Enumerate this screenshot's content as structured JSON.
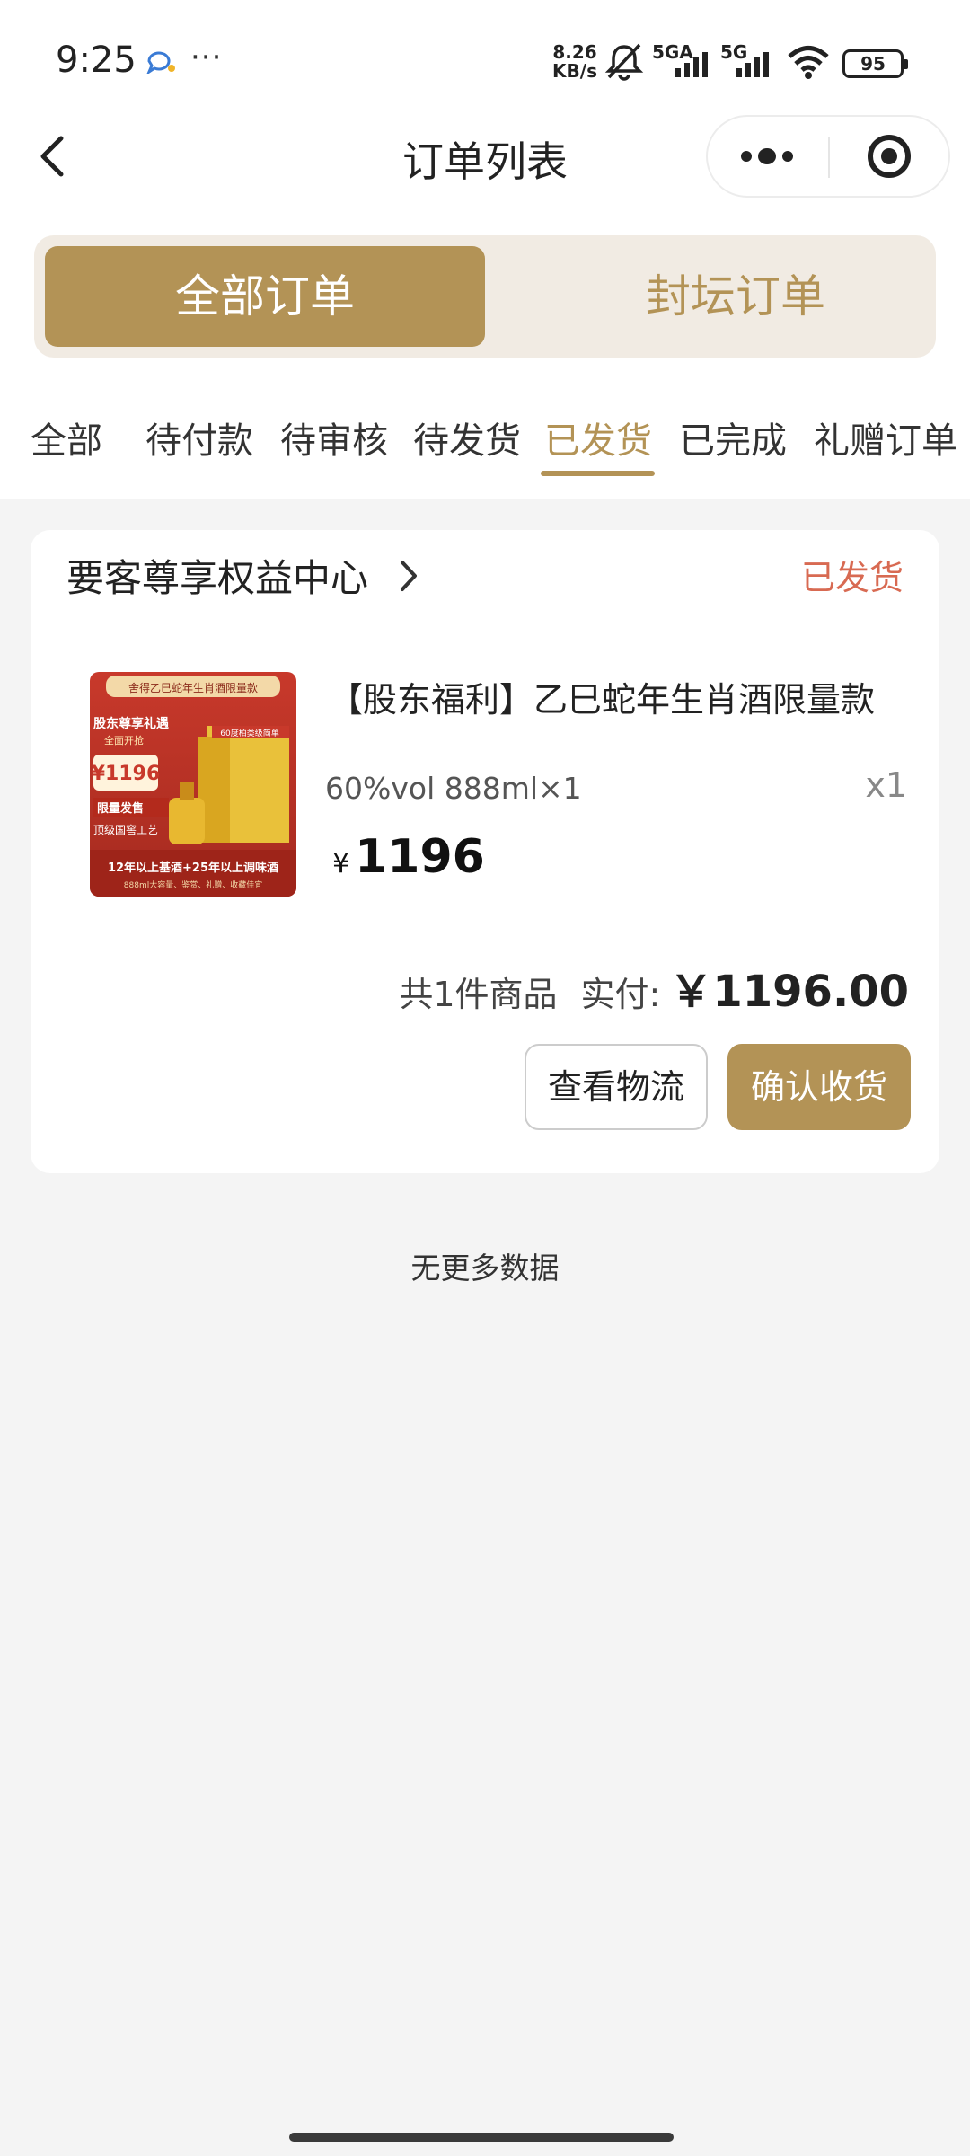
{
  "status_bar": {
    "time": "9:25",
    "more": "···",
    "speed_value": "8.26",
    "speed_unit": "KB/s",
    "network1": "5GA",
    "network2": "5G",
    "battery": "95"
  },
  "nav": {
    "title": "订单列表"
  },
  "segment": {
    "items": [
      {
        "label": "全部订单",
        "active": true
      },
      {
        "label": "封坛订单",
        "active": false
      }
    ]
  },
  "tabs": [
    {
      "label": "全部"
    },
    {
      "label": "待付款"
    },
    {
      "label": "待审核"
    },
    {
      "label": "待发货"
    },
    {
      "label": "已发货",
      "active": true
    },
    {
      "label": "已完成"
    },
    {
      "label": "礼赠订单"
    }
  ],
  "order": {
    "shop_name": "要客尊享权益中心",
    "status": "已发货",
    "product": {
      "title": "【股东福利】乙巳蛇年生肖酒限量款",
      "spec": "60%vol 888ml×1",
      "qty": "x1",
      "price_symbol": "¥",
      "price": "1196",
      "image": {
        "banner_text": "舍得乙巳蛇年生肖酒限量款",
        "gift_text": "股东尊享礼遇",
        "start_text": "全面开抢",
        "price_text": "¥1196",
        "limited_text": "限量发售",
        "craft_text": "顶级国窖工艺",
        "tag_text": "60度柏类级简单",
        "bottom_text": "12年以上基酒+25年以上调味酒",
        "sub_text": "888ml大容量、鉴赏、礼赠、收藏佳宜"
      }
    },
    "count_text": "共1件商品",
    "paid_label": "实付:",
    "paid_amount": "￥1196.00",
    "buttons": {
      "logistics": "查看物流",
      "confirm": "确认收货"
    }
  },
  "footer": {
    "no_more": "无更多数据"
  },
  "colors": {
    "accent": "#b39356",
    "segment_bg": "#f1ebe3",
    "status_shipped": "#d86a52",
    "page_bg": "#f4f4f4"
  }
}
